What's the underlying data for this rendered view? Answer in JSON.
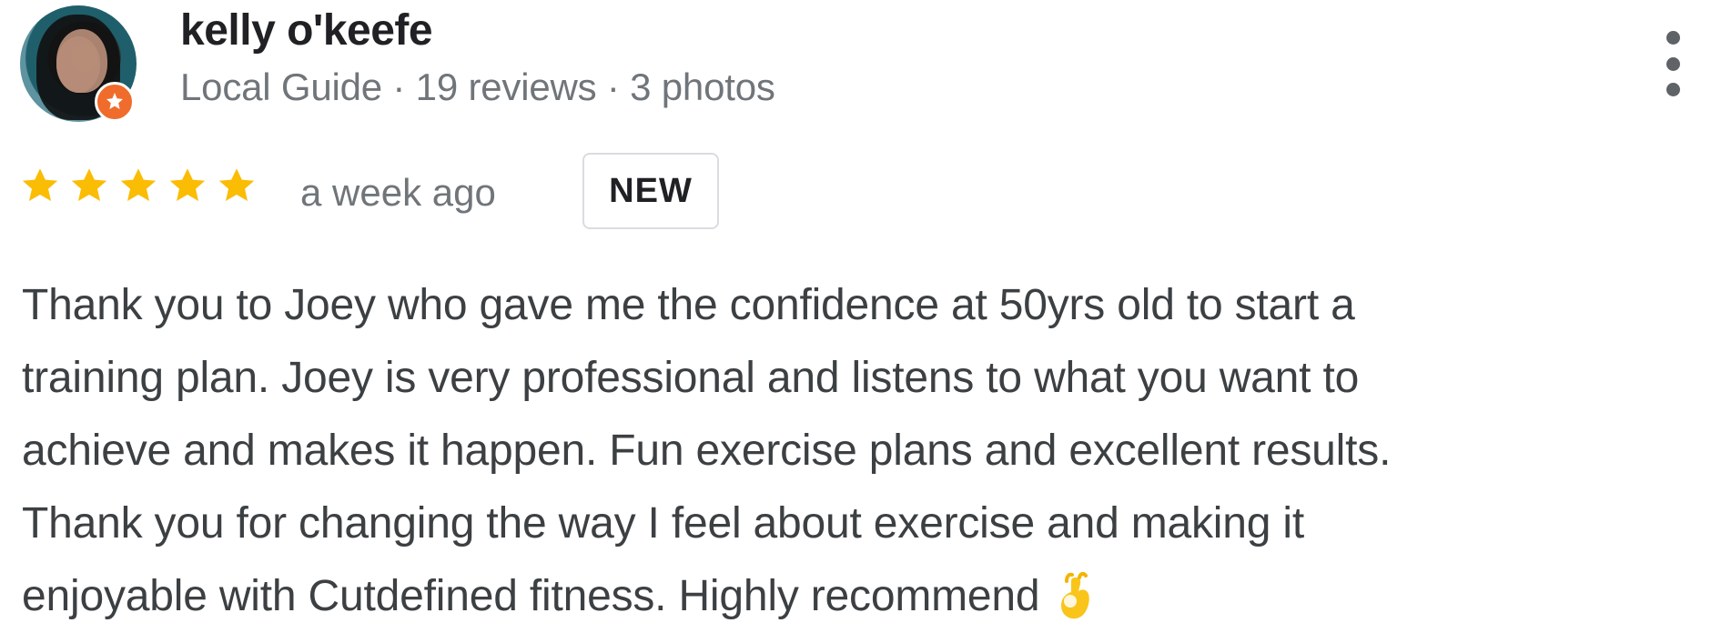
{
  "reviewer": {
    "name": "kelly o'keefe",
    "meta": "Local Guide · 19 reviews · 3 photos",
    "avatar_icon": "person-avatar-icon",
    "badge_icon": "local-guide-star-icon"
  },
  "review": {
    "rating": 5,
    "rating_max": 5,
    "time": "a week ago",
    "badge": "NEW",
    "lines": [
      "Thank you to Joey who gave me the confidence at 50yrs old to start a",
      "training plan. Joey is very professional and listens to what you want to",
      "achieve and makes it happen. Fun exercise plans and excellent results.",
      "Thank you for changing the way I feel about exercise and making it",
      "enjoyable with Cutdefined fitness. Highly recommend"
    ],
    "emoji": "ok-hand-emoji"
  },
  "colors": {
    "star": "#fbbc04",
    "name": "#202124",
    "meta": "#70757a",
    "body": "#3c4043",
    "badge_orange": "#ef6c2c",
    "menu": "#5f6368"
  },
  "menu": {
    "icon": "more-vertical-icon"
  }
}
